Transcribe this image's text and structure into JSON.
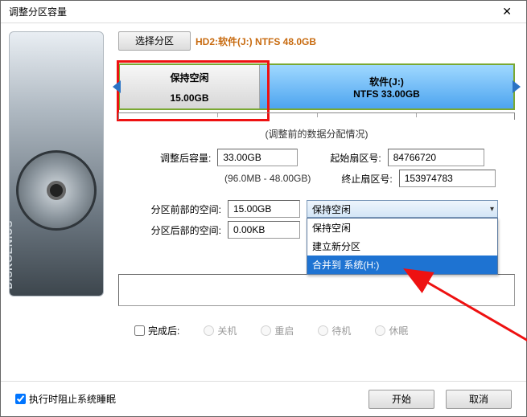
{
  "window": {
    "title": "调整分区容量"
  },
  "topbar": {
    "select_partition_label": "选择分区",
    "disk_path": "HD2:软件(J:) NTFS 48.0GB"
  },
  "partition_bar": {
    "free": {
      "label": "保持空闲",
      "size": "15.00GB"
    },
    "main": {
      "label": "软件(J:)",
      "fs_size": "NTFS 33.00GB"
    }
  },
  "caption": "(调整前的数据分配情况)",
  "form": {
    "size_after_label": "调整后容量:",
    "size_after_value": "33.00GB",
    "range_hint": "(96.0MB - 48.00GB)",
    "start_sector_label": "起始扇区号:",
    "start_sector_value": "84766720",
    "end_sector_label": "终止扇区号:",
    "end_sector_value": "153974783",
    "space_before_label": "分区前部的空间:",
    "space_before_value": "15.00GB",
    "space_after_label": "分区后部的空间:",
    "space_after_value": "0.00KB",
    "dropdown_selected": "保持空闲",
    "dropdown_options": [
      "保持空闲",
      "建立新分区",
      "合并到 系统(H:)"
    ]
  },
  "after_done": {
    "label": "完成后:",
    "opt_shutdown": "关机",
    "opt_reboot": "重启",
    "opt_standby": "待机",
    "opt_hibernate": "休眠"
  },
  "footer": {
    "prevent_sleep_label": "执行时阻止系统睡眠",
    "start_label": "开始",
    "cancel_label": "取消"
  }
}
